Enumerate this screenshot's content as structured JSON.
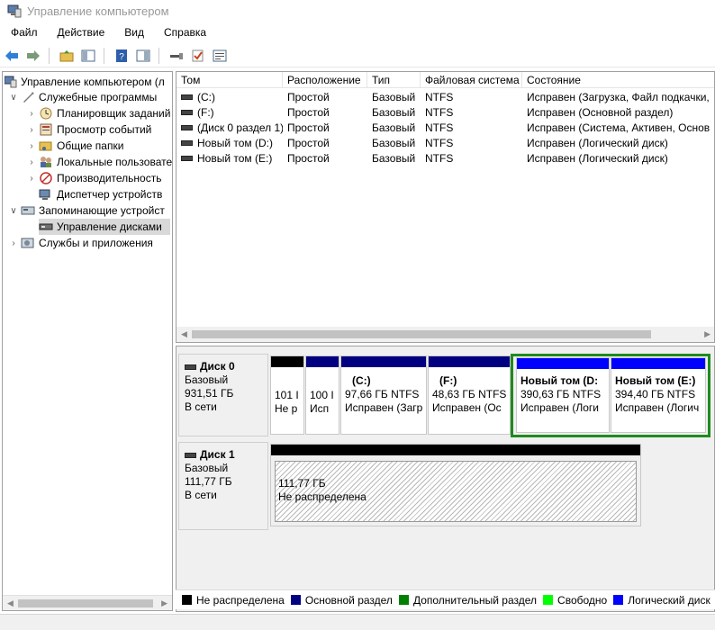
{
  "window": {
    "title": "Управление компьютером"
  },
  "menu": [
    "Файл",
    "Действие",
    "Вид",
    "Справка"
  ],
  "tree": [
    {
      "label": "Управление компьютером (л",
      "arrow": "",
      "indent": 0,
      "icon": "computer-management-icon",
      "color": "#6b8fb8"
    },
    {
      "label": "Служебные программы",
      "arrow": "v",
      "indent": 1,
      "icon": "tools-icon",
      "color": "#8b8b8b"
    },
    {
      "label": "Планировщик заданий",
      "arrow": ">",
      "indent": 2,
      "icon": "clock-icon",
      "color": "#c8a040"
    },
    {
      "label": "Просмотр событий",
      "arrow": ">",
      "indent": 2,
      "icon": "event-viewer-icon",
      "color": "#b04040"
    },
    {
      "label": "Общие папки",
      "arrow": ">",
      "indent": 2,
      "icon": "shared-folder-icon",
      "color": "#d8b040"
    },
    {
      "label": "Локальные пользовате",
      "arrow": ">",
      "indent": 2,
      "icon": "users-icon",
      "color": "#7a90b0"
    },
    {
      "label": "Производительность",
      "arrow": ">",
      "indent": 2,
      "icon": "performance-icon",
      "color": "#c03030"
    },
    {
      "label": "Диспетчер устройств",
      "arrow": "",
      "indent": 2,
      "icon": "device-manager-icon",
      "color": "#707070"
    },
    {
      "label": "Запоминающие устройст",
      "arrow": "v",
      "indent": 1,
      "icon": "storage-icon",
      "color": "#8090a0"
    },
    {
      "label": "Управление дисками",
      "arrow": "",
      "indent": 2,
      "icon": "disk-management-icon",
      "color": "#505050",
      "selected": true
    },
    {
      "label": "Службы и приложения",
      "arrow": ">",
      "indent": 1,
      "icon": "services-icon",
      "color": "#8090a0"
    }
  ],
  "volume_list": {
    "columns": [
      "Том",
      "Расположение",
      "Тип",
      "Файловая система",
      "Состояние"
    ],
    "rows": [
      [
        "(C:)",
        "Простой",
        "Базовый",
        "NTFS",
        "Исправен (Загрузка, Файл подкачки,"
      ],
      [
        "(F:)",
        "Простой",
        "Базовый",
        "NTFS",
        "Исправен (Основной раздел)"
      ],
      [
        "(Диск 0 раздел 1)",
        "Простой",
        "Базовый",
        "NTFS",
        "Исправен (Система, Активен, Основ"
      ],
      [
        "Новый том (D:)",
        "Простой",
        "Базовый",
        "NTFS",
        "Исправен (Логический диск)"
      ],
      [
        "Новый том (E:)",
        "Простой",
        "Базовый",
        "NTFS",
        "Исправен (Логический диск)"
      ]
    ]
  },
  "disks": [
    {
      "name": "Диск 0",
      "type": "Базовый",
      "size": "931,51 ГБ",
      "status": "В сети",
      "partitions": [
        {
          "line1": "",
          "line2": "101 I",
          "line3": "Не р",
          "bar": "#000000"
        },
        {
          "line1": "",
          "line2": "100 I",
          "line3": "Исп",
          "bar": "#000080"
        },
        {
          "line1": "(C:)",
          "line2": "97,66 ГБ NTFS",
          "line3": "Исправен (Загр",
          "bar": "#000080"
        },
        {
          "line1": "(F:)",
          "line2": "48,63 ГБ NTFS",
          "line3": "Исправен (Ос",
          "bar": "#000080"
        },
        {
          "line1": "Новый том  (D:",
          "line2": "390,63 ГБ NTFS",
          "line3": "Исправен (Логи",
          "bar": "#0000ff"
        },
        {
          "line1": "Новый том  (E:)",
          "line2": "394,40 ГБ NTFS",
          "line3": "Исправен (Логич",
          "bar": "#0000ff"
        }
      ]
    },
    {
      "name": "Диск 1",
      "type": "Базовый",
      "size": "111,77 ГБ",
      "status": "В сети",
      "partitions": [
        {
          "line1": "",
          "line2": "111,77 ГБ",
          "line3": "Не распределена",
          "bar": "#000000"
        }
      ]
    }
  ],
  "legend": [
    {
      "label": "Не распределена",
      "color": "#000000"
    },
    {
      "label": "Основной раздел",
      "color": "#000080"
    },
    {
      "label": "Дополнительный раздел",
      "color": "#008000"
    },
    {
      "label": "Свободно",
      "color": "#00ff00"
    },
    {
      "label": "Логический диск",
      "color": "#0000ff"
    }
  ]
}
